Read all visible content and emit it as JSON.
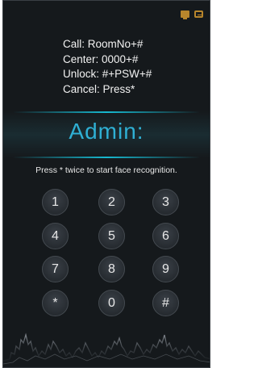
{
  "status_icons": [
    "monitor-icon",
    "door-phone-icon"
  ],
  "help_lines": {
    "call": "Call: RoomNo+#",
    "center": "Center: 0000+#",
    "unlock": "Unlock: #+PSW+#",
    "cancel": "Cancel: Press*"
  },
  "prompt_label": "Admin:",
  "hint_text": "Press * twice to start face recognition.",
  "keypad": {
    "k1": "1",
    "k2": "2",
    "k3": "3",
    "k4": "4",
    "k5": "5",
    "k6": "6",
    "k7": "7",
    "k8": "8",
    "k9": "9",
    "kstar": "*",
    "k0": "0",
    "khash": "#"
  },
  "colors": {
    "background": "#15191c",
    "accent": "#2fb0d4",
    "icon": "#b8862c",
    "text": "#f2f2f2"
  }
}
